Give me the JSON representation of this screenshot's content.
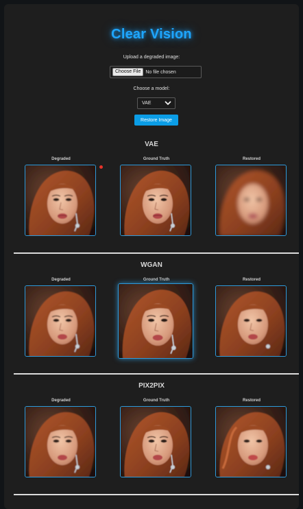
{
  "app": {
    "title": "Clear Vision",
    "upload_label": "Upload a degraded image:",
    "file_button": "Choose File",
    "file_status": "No file chosen",
    "model_label": "Choose a model:",
    "model_selected": "VAE",
    "restore_button": "Restore Image"
  },
  "sections": [
    {
      "title": "VAE",
      "columns": [
        "Degraded",
        "Ground Truth",
        "Restored"
      ]
    },
    {
      "title": "WGAN",
      "columns": [
        "Degraded",
        "Ground Truth",
        "Restored"
      ]
    },
    {
      "title": "PIX2PIX",
      "columns": [
        "Degraded",
        "Ground Truth",
        "Restored"
      ]
    }
  ],
  "colors": {
    "accent": "#1ea6ff",
    "button": "#0b9de6",
    "frame": "#2e9bdc",
    "background": "#1e1e1e"
  }
}
